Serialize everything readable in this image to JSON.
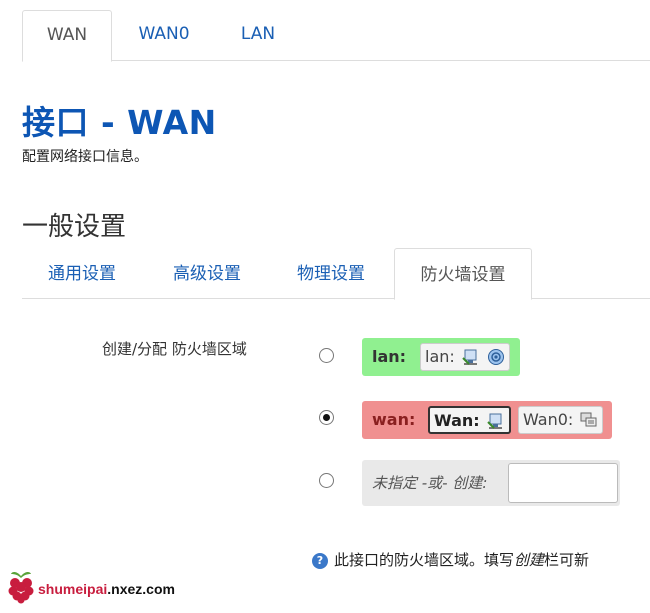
{
  "top_tabs": [
    {
      "label": "WAN",
      "active": true
    },
    {
      "label": "WAN0",
      "active": false
    },
    {
      "label": "LAN",
      "active": false
    }
  ],
  "page": {
    "title": "接口 - WAN",
    "subtitle": "配置网络接口信息。",
    "section_title": "一般设置"
  },
  "sub_tabs": [
    {
      "label": "通用设置",
      "active": false
    },
    {
      "label": "高级设置",
      "active": false
    },
    {
      "label": "物理设置",
      "active": false
    },
    {
      "label": "防火墙设置",
      "active": true
    }
  ],
  "firewall": {
    "field_label": "创建/分配 防火墙区域",
    "zones": [
      {
        "name": "lan:",
        "color": "#90f090",
        "checked": false,
        "networks": [
          {
            "label": "lan:",
            "icons": [
              "ethernet-icon",
              "wireless-icon"
            ],
            "selected": false
          }
        ]
      },
      {
        "name": "wan:",
        "color": "#f09090",
        "checked": true,
        "networks": [
          {
            "label": "Wan:",
            "icons": [
              "ethernet-icon"
            ],
            "selected": true
          },
          {
            "label": "Wan0:",
            "icons": [
              "bridge-icon"
            ],
            "selected": false
          }
        ]
      }
    ],
    "unspecified": {
      "label": "未指定 -或- 创建:",
      "checked": false,
      "input_value": ""
    },
    "help_text_prefix": "此接口的防火墙区域。填写",
    "help_text_em": "创建",
    "help_text_suffix": "栏可新"
  },
  "watermark": {
    "text_main": "shumeipai",
    "text_domain": ".nxez",
    "text_tld": ".com"
  }
}
